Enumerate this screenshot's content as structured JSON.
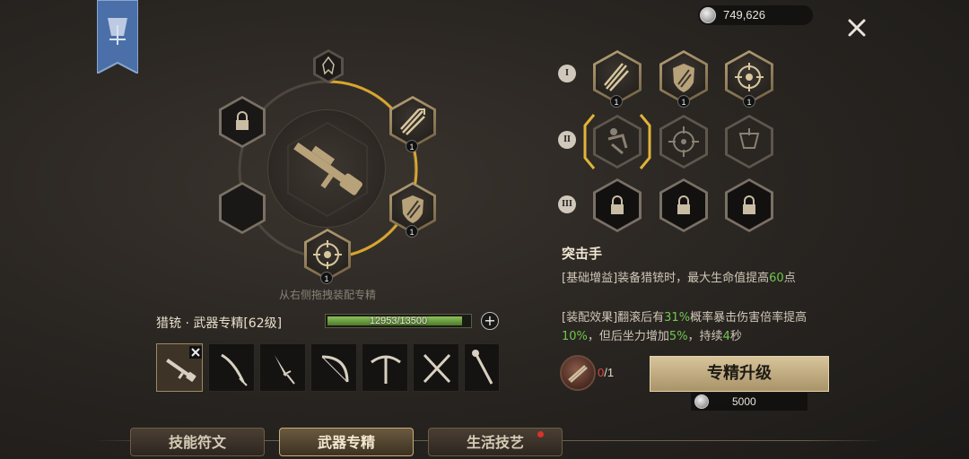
{
  "currency": {
    "amount": "749,626",
    "icon": "silver-coin-icon"
  },
  "ring": {
    "drag_hint": "从右侧拖拽装配专精",
    "slots": [
      {
        "icon": "locked-slot",
        "count": ""
      },
      {
        "icon": "arrow-burst-skill",
        "count": "1"
      },
      {
        "icon": "empty-slot",
        "count": ""
      },
      {
        "icon": "shield-skill",
        "count": "1"
      },
      {
        "icon": "crosshair-skill",
        "count": "1"
      }
    ]
  },
  "spec": {
    "title": "猎铳 · 武器专精[62级]",
    "xp_text": "12953/13500",
    "xp_fraction": 0.9595
  },
  "weapons": [
    "musket",
    "scimitar",
    "dagger",
    "bow",
    "crossbow",
    "dual-blades",
    "staff"
  ],
  "tiers": [
    {
      "label": "I",
      "skills": [
        {
          "icon": "arrow-burst-skill",
          "count": "1"
        },
        {
          "icon": "shield-skill",
          "count": "1"
        },
        {
          "icon": "crosshair-skill",
          "count": "1"
        }
      ]
    },
    {
      "label": "II",
      "skills": [
        {
          "icon": "roll-skill",
          "count": ""
        },
        {
          "icon": "target-skill",
          "count": ""
        },
        {
          "icon": "banner-skill",
          "count": ""
        }
      ]
    },
    {
      "label": "III",
      "skills": [
        {
          "icon": "lock",
          "count": ""
        },
        {
          "icon": "lock",
          "count": ""
        },
        {
          "icon": "lock",
          "count": ""
        }
      ]
    }
  ],
  "detail": {
    "title": "突击手",
    "base_prefix": "[基础增益]装备猎铳时，最大生命值提高",
    "base_value": "60",
    "base_suffix": "点",
    "equip_prefix": "[装配效果]翻滚后有",
    "equip_v1": "31%",
    "equip_mid1": "概率暴击伤害倍率提高",
    "equip_v2": "10%",
    "equip_mid2": "，但后坐力增加",
    "equip_v3": "5%",
    "equip_mid3": "，持续",
    "equip_v4": "4",
    "equip_suffix": "秒"
  },
  "upgrade": {
    "have": "0",
    "need": "/1",
    "button_label": "专精升级",
    "cost": "5000"
  },
  "tabs": [
    {
      "label": "技能符文",
      "active": false
    },
    {
      "label": "武器专精",
      "active": true
    },
    {
      "label": "生活技艺",
      "active": false
    }
  ],
  "colors": {
    "accent_gold": "#e0b33a",
    "green_value": "#6fc84e",
    "red_count": "#e04a3a"
  }
}
